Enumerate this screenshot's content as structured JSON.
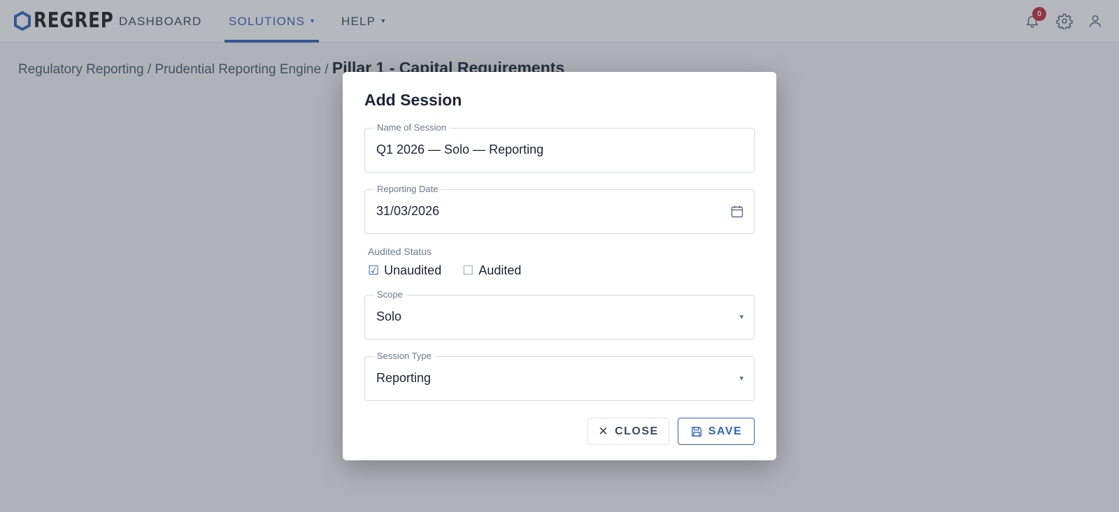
{
  "app": {
    "logo_text": "REGREP",
    "brand_color": "#2f63c4"
  },
  "nav": {
    "items": [
      {
        "label": "DASHBOARD",
        "active": false,
        "has_dropdown": false
      },
      {
        "label": "SOLUTIONS",
        "active": true,
        "has_dropdown": true
      },
      {
        "label": "HELP",
        "active": false,
        "has_dropdown": true
      }
    ],
    "caret": "▾",
    "notifications_count": "0",
    "icons": [
      "bell-icon",
      "gear-icon",
      "user-icon"
    ]
  },
  "breadcrumb": {
    "parts": [
      "Regulatory Reporting",
      "Prudential Reporting Engine"
    ],
    "separator": "/",
    "current": "Pillar 1 - Capital Requirements"
  },
  "modal": {
    "title": "Add Session",
    "name_field": {
      "label": "Name of Session",
      "value": "Q1 2026 — Solo — Reporting"
    },
    "date_field": {
      "label": "Reporting Date",
      "value": "31/03/2026",
      "icon": "calendar-icon"
    },
    "audited": {
      "label": "Audited Status",
      "options": [
        {
          "label": "Unaudited",
          "checked": true,
          "mark": "☑"
        },
        {
          "label": "Audited",
          "checked": false,
          "mark": "☐"
        }
      ]
    },
    "scope_field": {
      "label": "Scope",
      "value": "Solo",
      "caret": "▾"
    },
    "type_field": {
      "label": "Session Type",
      "value": "Reporting",
      "caret": "▾"
    },
    "buttons": {
      "close": {
        "label": "CLOSE",
        "icon_glyph": "✕"
      },
      "save": {
        "label": "SAVE",
        "icon": "save-icon"
      }
    }
  }
}
